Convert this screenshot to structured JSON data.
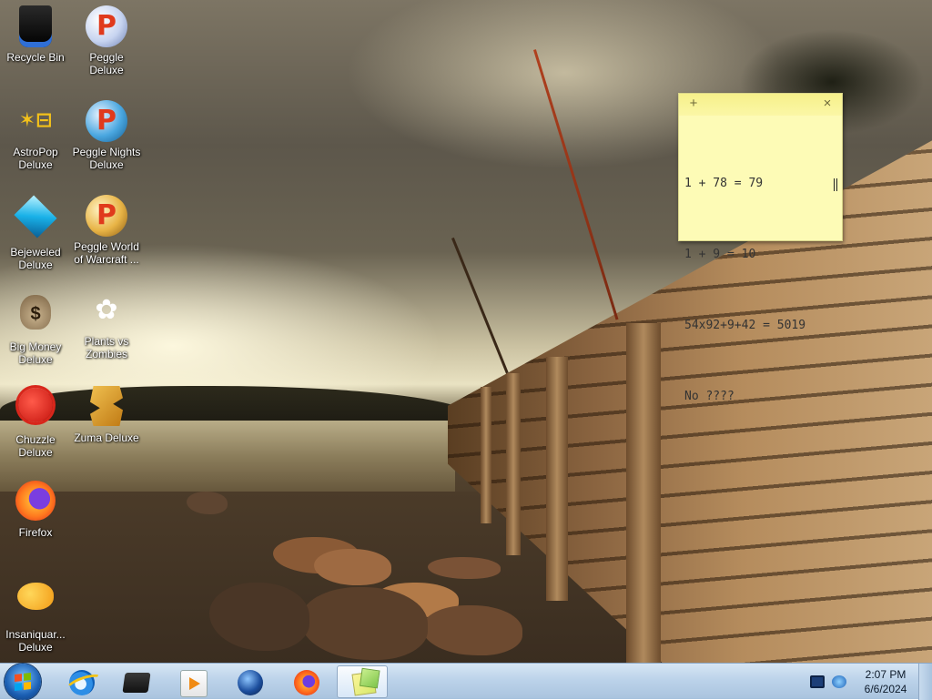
{
  "desktop_icons": [
    {
      "label": "Recycle Bin",
      "icon": "recycle-bin-icon"
    },
    {
      "label": "Peggle Deluxe",
      "icon": "peggle-icon"
    },
    {
      "label": "AstroPop Deluxe",
      "icon": "astropop-icon"
    },
    {
      "label": "Peggle Nights Deluxe",
      "icon": "peggle-nights-icon"
    },
    {
      "label": "Bejeweled Deluxe",
      "icon": "bejeweled-icon"
    },
    {
      "label": "Peggle World of Warcraft ...",
      "icon": "peggle-wow-icon"
    },
    {
      "label": "Big Money Deluxe",
      "icon": "big-money-icon"
    },
    {
      "label": "Plants vs Zombies",
      "icon": "plants-vs-zombies-icon"
    },
    {
      "label": "Chuzzle Deluxe",
      "icon": "chuzzle-icon"
    },
    {
      "label": "Zuma Deluxe",
      "icon": "zuma-icon"
    },
    {
      "label": "Firefox",
      "icon": "firefox-icon"
    },
    {
      "label": "Insaniquar... Deluxe",
      "icon": "insaniquarium-icon"
    }
  ],
  "sticky_note": {
    "add_glyph": "+",
    "close_glyph": "×",
    "lines": [
      "1 + 78 = 79",
      "1 + 9 = 10",
      "54x92+9+42 = 5019",
      "No ????"
    ],
    "color": "#fdfbb6"
  },
  "taskbar": {
    "start_label": "Start",
    "pinned": [
      "internet-explorer",
      "windows-explorer",
      "windows-media-player",
      "globe-app",
      "firefox",
      "sticky-notes"
    ],
    "active": "sticky-notes",
    "clock": {
      "time": "2:07 PM",
      "date": "6/6/2024"
    },
    "tray": [
      "display-icon",
      "network-icon"
    ]
  }
}
